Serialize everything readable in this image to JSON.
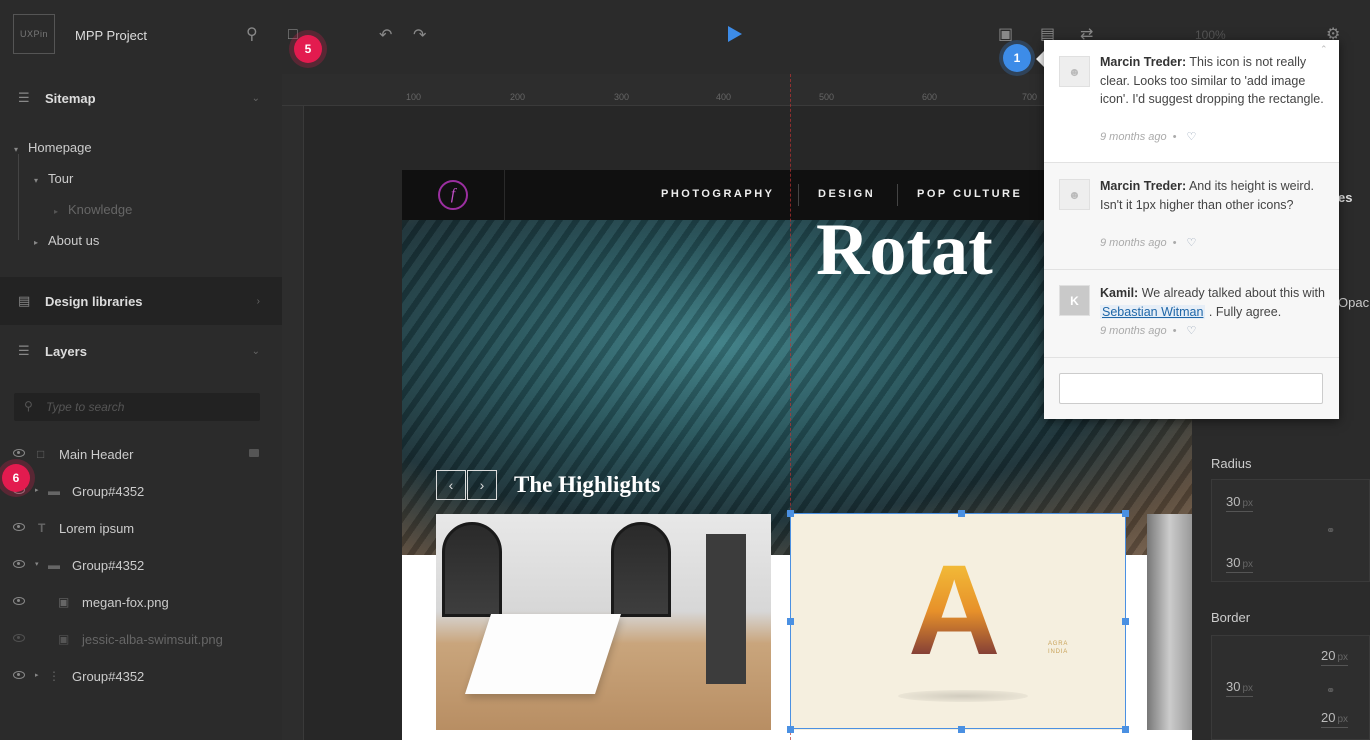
{
  "app": {
    "logo_text": "UXPin",
    "project_name": "MPP Project",
    "zoom_level": "100%"
  },
  "badges": {
    "b5": "5",
    "b6": "6",
    "b1": "1"
  },
  "sidebar": {
    "sitemap_title": "Sitemap",
    "sitemap": [
      {
        "label": "Homepage"
      },
      {
        "label": "Tour"
      },
      {
        "label": "Knowledge"
      },
      {
        "label": "About us"
      }
    ],
    "design_libraries_title": "Design libraries",
    "layers_title": "Layers",
    "search_placeholder": "Type to search",
    "layers": [
      {
        "label": "Main Header"
      },
      {
        "label": "Group#4352"
      },
      {
        "label": "Lorem ipsum"
      },
      {
        "label": "Group#4352"
      },
      {
        "label": "megan-fox.png"
      },
      {
        "label": "jessic-alba-swimsuit.png"
      },
      {
        "label": "Group#4352"
      }
    ]
  },
  "ruler": {
    "ticks": [
      "100",
      "200",
      "300",
      "400",
      "500",
      "600",
      "700"
    ]
  },
  "artboard": {
    "nav_logo": "f",
    "nav": [
      "PHOTOGRAPHY",
      "DESIGN",
      "POP CULTURE"
    ],
    "hero_title": "Rotat",
    "highlights_title": "The Highlights",
    "poster_letter": "A",
    "poster_city": "AGRA",
    "poster_country": "INDIA"
  },
  "comments": [
    {
      "author": "Marcin Treder:",
      "text": "This icon is not really clear. Looks too similar to 'add image icon'. I'd suggest dropping the rectangle.",
      "time": "9 months ago"
    },
    {
      "author": "Marcin Treder:",
      "text": "And its height is weird. Isn't it 1px higher than other icons?",
      "time": "9 months ago"
    },
    {
      "author": "Kamil:",
      "text_before": "We already talked about this with",
      "mention": "Sebastian Witman",
      "text_after": ". Fully agree.",
      "time": "9 months ago",
      "avatar_letter": "K"
    }
  ],
  "panel": {
    "tab_fragment": "es",
    "opacity_fragment": "Opac",
    "radius_label": "Radius",
    "radius_top": "30",
    "radius_bottom": "30",
    "border_label": "Border",
    "border_right_top": "20",
    "border_left": "30",
    "border_right_bottom": "20",
    "unit": "px"
  },
  "colors": {
    "accent": "#3d8ce8",
    "badge_red": "#e31b4f",
    "selection": "#4a90e2"
  }
}
